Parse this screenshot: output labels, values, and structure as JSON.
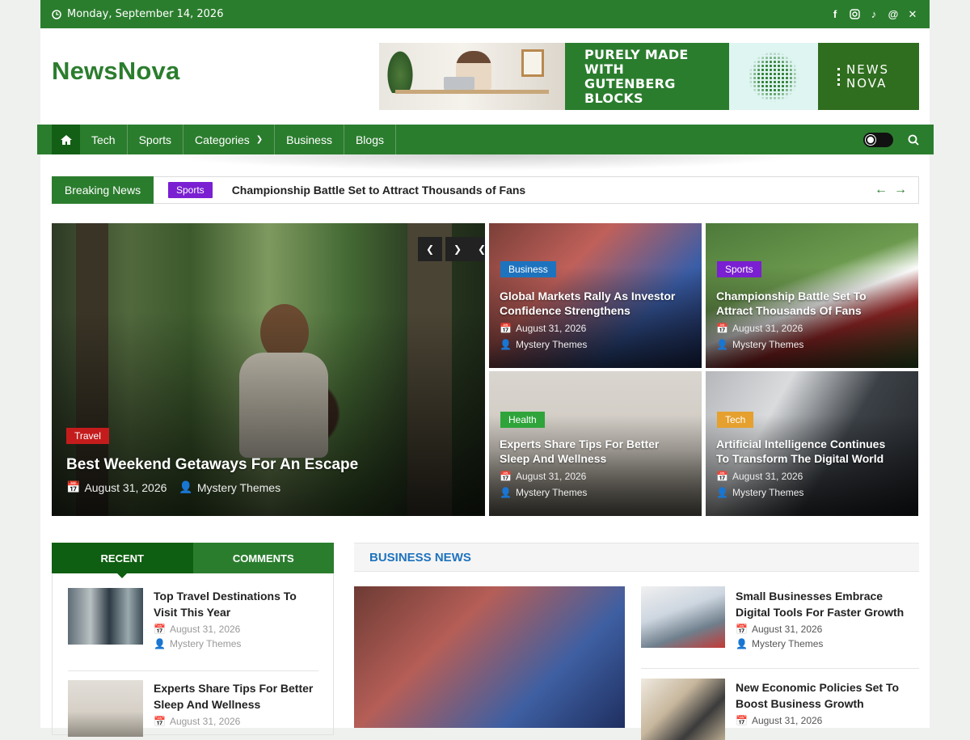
{
  "topbar": {
    "date": "Monday, September 14, 2026",
    "social_icons": [
      "facebook-icon",
      "instagram-icon",
      "tiktok-icon",
      "threads-icon",
      "x-icon"
    ]
  },
  "header": {
    "logo": "NewsNova",
    "banner": {
      "headline_line1": "PURELY MADE WITH",
      "headline_line2": "GUTENBERG BLOCKS",
      "brand_line1": "NEWS",
      "brand_line2": "NOVA"
    }
  },
  "nav": {
    "items": [
      "Tech",
      "Sports",
      "Categories",
      "Business",
      "Blogs"
    ]
  },
  "breaking": {
    "label": "Breaking News",
    "tag": "Sports",
    "title": "Championship Battle Set to Attract Thousands of Fans"
  },
  "hero": {
    "main": {
      "category": "Travel",
      "title": "Best Weekend Getaways For An Escape",
      "date": "August 31, 2026",
      "author": "Mystery Themes"
    },
    "cards": [
      {
        "category": "Business",
        "title_line1": "Global Markets Rally As Investor",
        "title_line2": "Confidence Strengthens",
        "date": "August 31, 2026",
        "author": "Mystery Themes"
      },
      {
        "category": "Sports",
        "title_line1": "Championship Battle Set To",
        "title_line2": "Attract Thousands Of Fans",
        "date": "August 31, 2026",
        "author": "Mystery Themes"
      },
      {
        "category": "Health",
        "title_line1": "Experts Share Tips For Better",
        "title_line2": "Sleep And Wellness",
        "date": "August 31, 2026",
        "author": "Mystery Themes"
      },
      {
        "category": "Tech",
        "title_line1": "Artificial Intelligence Continues",
        "title_line2": "To Transform The Digital World",
        "date": "August 31, 2026",
        "author": "Mystery Themes"
      }
    ]
  },
  "tabs": {
    "recent": "RECENT",
    "comments": "COMMENTS",
    "items": [
      {
        "title": "Top Travel Destinations To Visit This Year",
        "date": "August 31, 2026",
        "author": "Mystery Themes"
      },
      {
        "title": "Experts Share Tips For Better Sleep And Wellness",
        "date": "August 31, 2026"
      }
    ]
  },
  "business": {
    "heading": "BUSINESS NEWS",
    "items": [
      {
        "title": "Small Businesses Embrace Digital Tools For Faster Growth",
        "date": "August 31, 2026",
        "author": "Mystery Themes"
      },
      {
        "title": "New Economic Policies Set To Boost Business Growth",
        "date": "August 31, 2026"
      }
    ]
  },
  "colors": {
    "primary": "#2b7d2e",
    "dark": "#0f5f12",
    "link_blue": "#1e73be",
    "travel": "#c41c1c",
    "business": "#1e73be",
    "sports": "#7a1fd1",
    "health": "#2ea43a",
    "tech": "#e5a02e"
  }
}
